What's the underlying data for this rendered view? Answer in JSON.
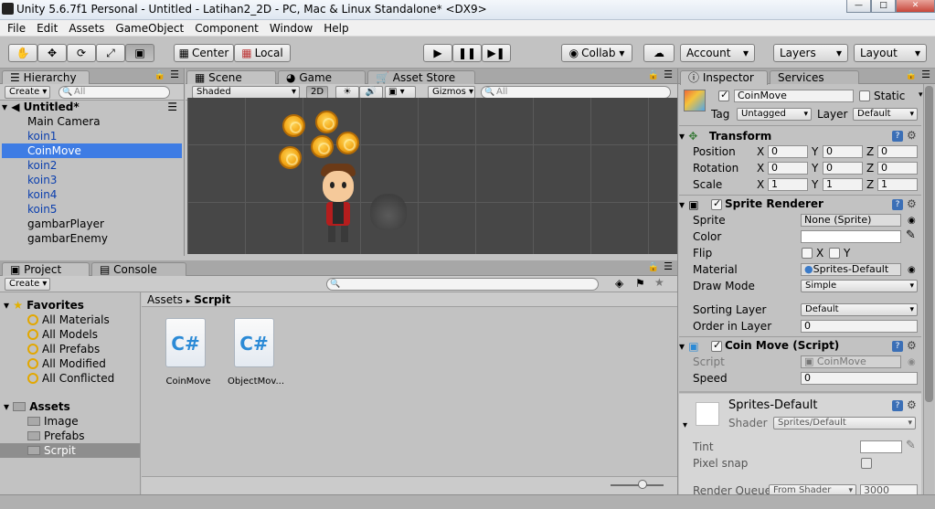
{
  "window": {
    "title": "Unity 5.6.7f1 Personal - Untitled - Latihan2_2D - PC, Mac & Linux Standalone* <DX9>"
  },
  "menu": [
    "File",
    "Edit",
    "Assets",
    "GameObject",
    "Component",
    "Window",
    "Help"
  ],
  "toolbar": {
    "pivot": "Center",
    "space": "Local",
    "collab": "Collab ▾",
    "account": "Account",
    "layers": "Layers",
    "layout": "Layout"
  },
  "hierarchy": {
    "tab": "Hierarchy",
    "create": "Create",
    "search_placeholder": "All",
    "scene": "Untitled*",
    "items": [
      "Main Camera",
      "koin1",
      "CoinMove",
      "koin2",
      "koin3",
      "koin4",
      "koin5",
      "gambarPlayer",
      "gambarEnemy"
    ]
  },
  "scene": {
    "tabs": [
      "Scene",
      "Game",
      "Asset Store"
    ],
    "shading": "Shaded",
    "mode2d": "2D",
    "gizmos": "Gizmos",
    "search_placeholder": "All"
  },
  "project": {
    "tabs": [
      "Project",
      "Console"
    ],
    "create": "Create",
    "favorites_label": "Favorites",
    "favorites": [
      "All Materials",
      "All Models",
      "All Prefabs",
      "All Modified",
      "All Conflicted"
    ],
    "assets_label": "Assets",
    "folders": [
      "Image",
      "Prefabs",
      "Scrpit"
    ],
    "breadcrumb": [
      "Assets",
      "Scrpit"
    ],
    "files": [
      {
        "name": "CoinMove",
        "icon": "csharp-script-icon",
        "glyph": "C#"
      },
      {
        "name": "ObjectMov...",
        "icon": "csharp-script-icon",
        "glyph": "C#"
      }
    ],
    "slider_level": 0.6
  },
  "inspector": {
    "tabs": [
      "Inspector",
      "Services"
    ],
    "object_name": "CoinMove",
    "static_label": "Static",
    "tag_label": "Tag",
    "tag": "Untagged",
    "layer_label": "Layer",
    "layer": "Default",
    "transform": {
      "title": "Transform",
      "rows": [
        {
          "label": "Position",
          "x": "0",
          "y": "0",
          "z": "0"
        },
        {
          "label": "Rotation",
          "x": "0",
          "y": "0",
          "z": "0"
        },
        {
          "label": "Scale",
          "x": "1",
          "y": "1",
          "z": "1"
        }
      ],
      "axes": [
        "X",
        "Y",
        "Z"
      ]
    },
    "sprite_renderer": {
      "title": "Sprite Renderer",
      "sprite_label": "Sprite",
      "sprite": "None (Sprite)",
      "color_label": "Color",
      "flip_label": "Flip",
      "flip_x": "X",
      "flip_y": "Y",
      "material_label": "Material",
      "material": "Sprites-Default",
      "draw_mode_label": "Draw Mode",
      "draw_mode": "Simple",
      "sorting_layer_label": "Sorting Layer",
      "sorting_layer": "Default",
      "order_label": "Order in Layer",
      "order": "0"
    },
    "coin_move": {
      "title": "Coin Move (Script)",
      "script_label": "Script",
      "script": "CoinMove",
      "speed_label": "Speed",
      "speed": "0"
    },
    "material": {
      "name": "Sprites-Default",
      "shader_label": "Shader",
      "shader": "Sprites/Default",
      "tint_label": "Tint",
      "pixel_snap_label": "Pixel snap",
      "render_queue_label": "Render Queue",
      "render_queue_mode": "From Shader",
      "render_queue": "3000"
    }
  }
}
